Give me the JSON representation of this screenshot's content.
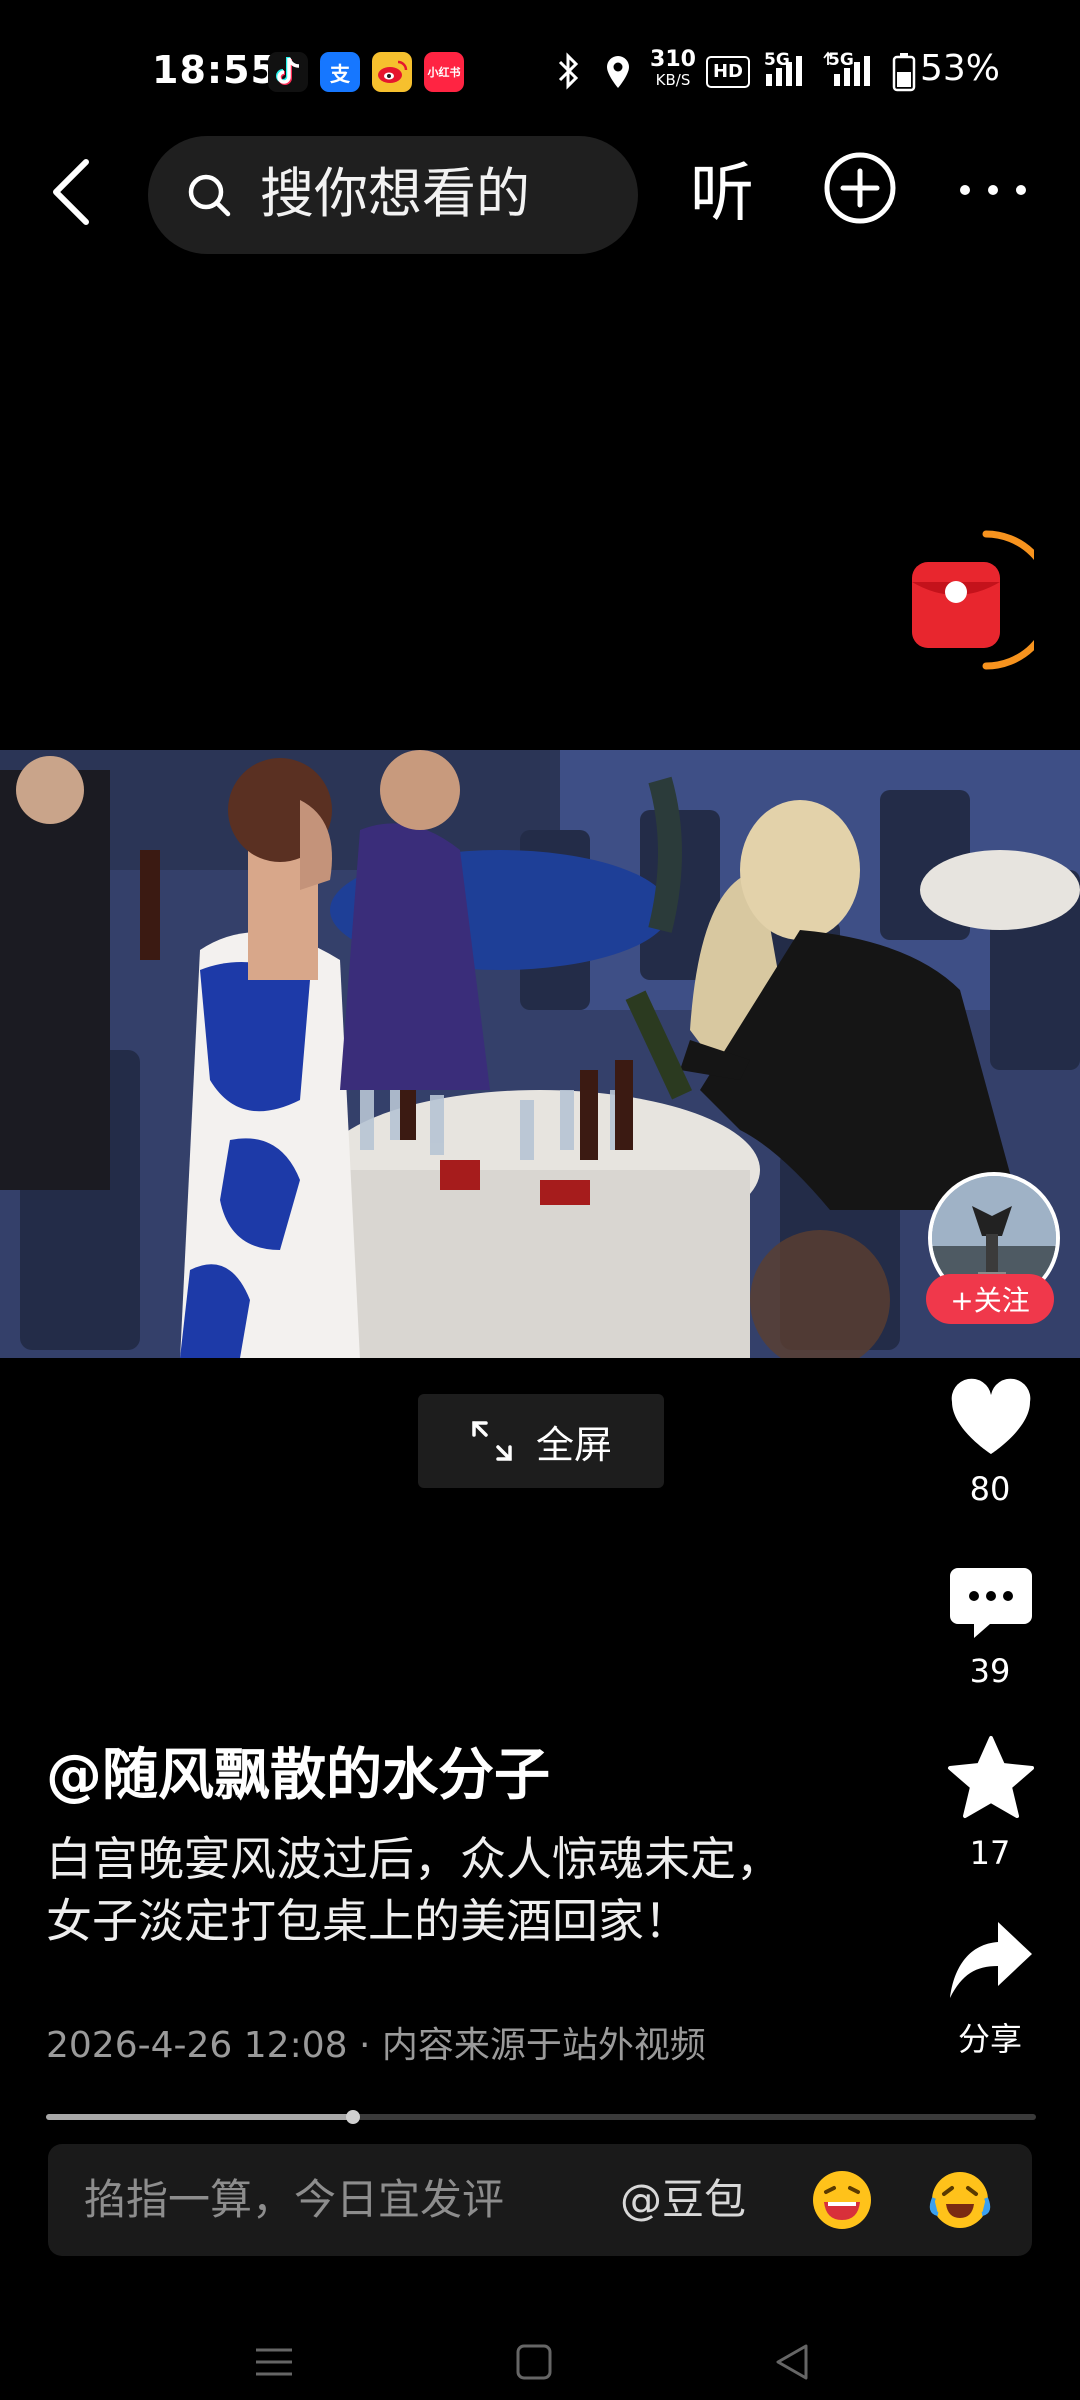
{
  "status_bar": {
    "time": "18:55",
    "apps": [
      "tiktok-icon",
      "alipay-icon",
      "weibo-icon",
      "xiaohongshu-icon"
    ],
    "alipay_label": "支",
    "xiaohongshu_label": "小红书",
    "network_speed_value": "310",
    "network_speed_unit": "KB/S",
    "hd_label": "HD",
    "signal1_label": "5G",
    "signal2_label": "5G",
    "battery": "53%"
  },
  "top_bar": {
    "search_placeholder": "搜你想看的",
    "listen_label": "听"
  },
  "video": {
    "fullscreen_label": "全屏"
  },
  "rail": {
    "follow_label": "+关注",
    "likes": "80",
    "comments": "39",
    "favorites": "17",
    "share_label": "分享"
  },
  "post": {
    "author": "@随风飘散的水分子",
    "description": "白宫晚宴风波过后，众人惊魂未定，女子淡定打包桌上的美酒回家！",
    "meta": "2026-4-26 12:08 · 内容来源于站外视频",
    "progress": 0.31
  },
  "comment_bar": {
    "placeholder": "掐指一算，今日宜发评",
    "mention": "@豆包"
  },
  "colors": {
    "accent_red": "#f0384b",
    "ring_orange": "#f7931e"
  }
}
